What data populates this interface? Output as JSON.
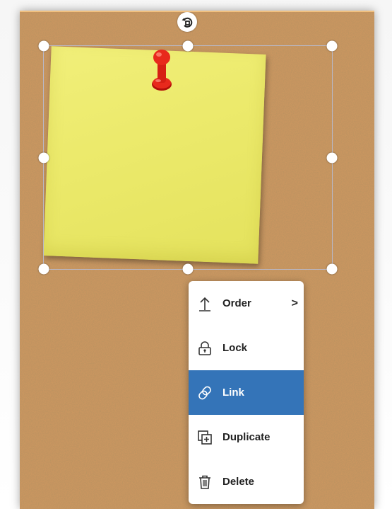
{
  "menu": {
    "items": [
      {
        "label": "Order",
        "icon": "arrow-up-icon",
        "submenu": true
      },
      {
        "label": "Lock",
        "icon": "lock-icon"
      },
      {
        "label": "Link",
        "icon": "link-icon",
        "active": true
      },
      {
        "label": "Duplicate",
        "icon": "duplicate-icon"
      },
      {
        "label": "Delete",
        "icon": "trash-icon"
      }
    ],
    "submenu_indicator": ">"
  },
  "colors": {
    "cork": "#c08a55",
    "note": "#ecea6c",
    "pin": "#e8291c",
    "menu_active": "#3474b8",
    "menu_text": "#222222"
  },
  "selection": {
    "rotate_icon": "rotate-icon"
  }
}
